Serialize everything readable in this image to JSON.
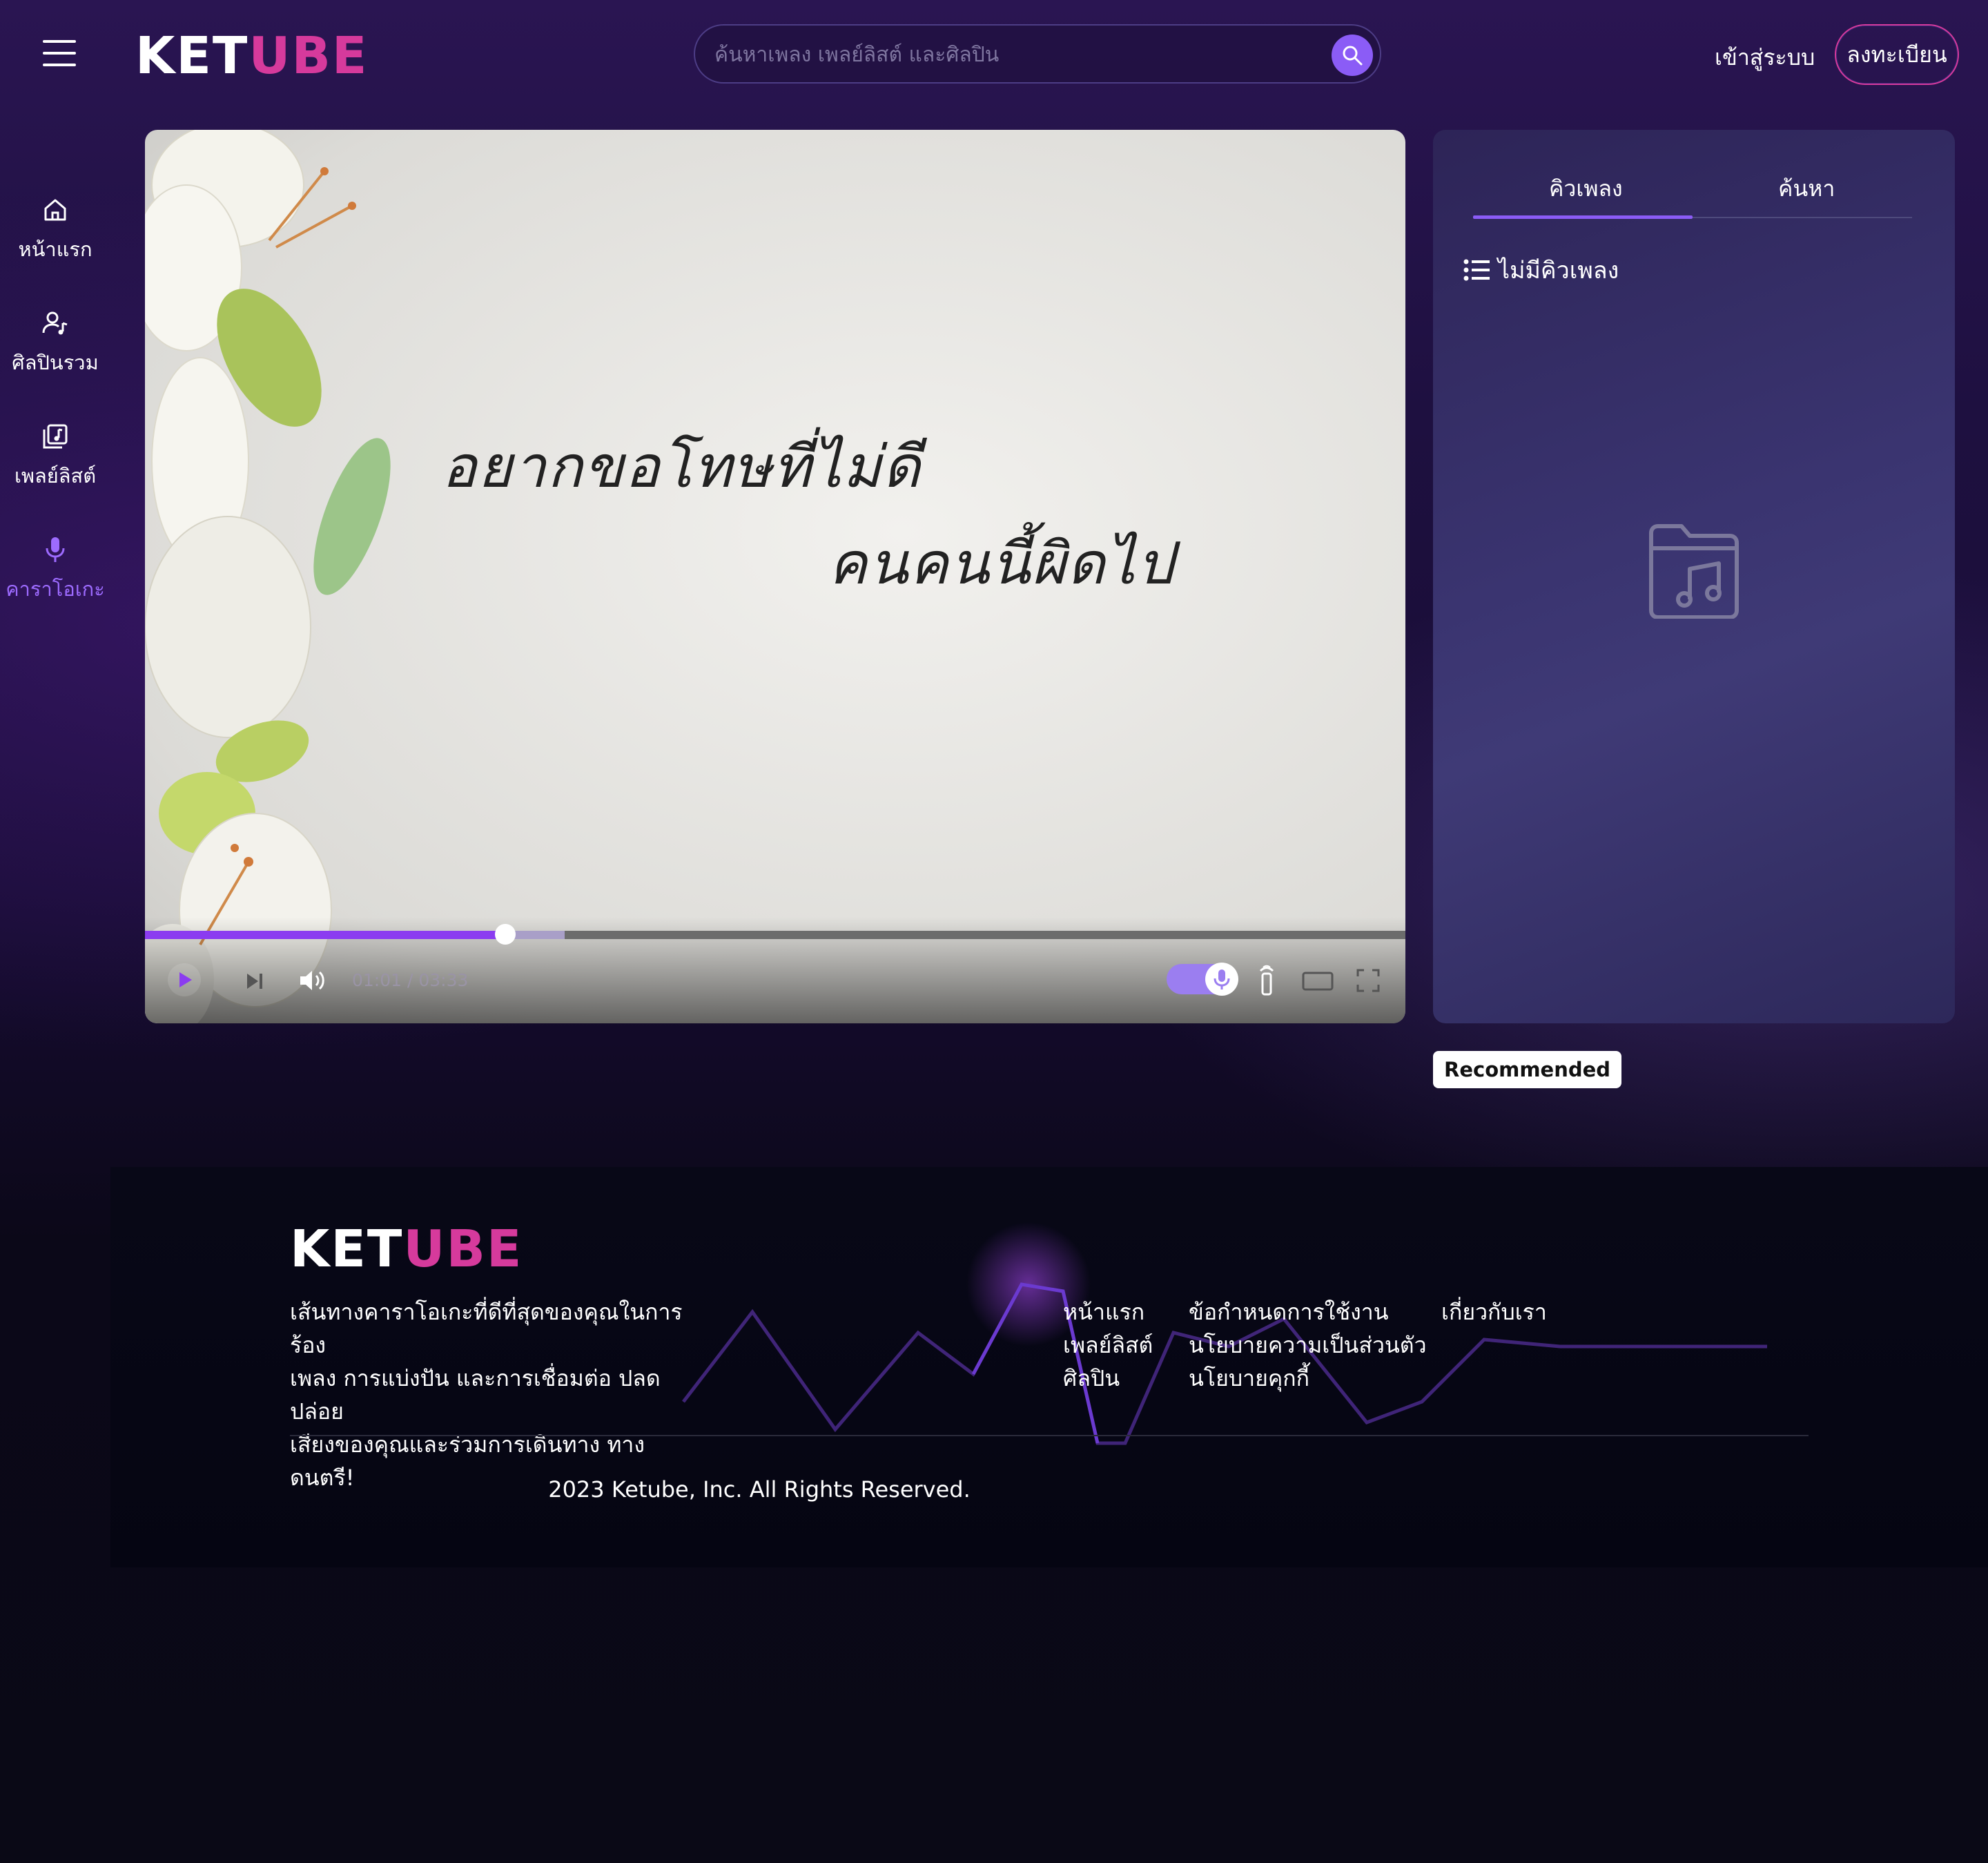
{
  "header": {
    "logo": {
      "part1": "KET",
      "part2": "ᑌBE",
      "colors": {
        "white": "#ffffff",
        "pink": "#d63a9c"
      }
    },
    "search_placeholder": "ค้นหาเพลง เพลย์ลิสต์ และศิลปิน",
    "login_label": "เข้าสู่ระบบ",
    "register_label": "ลงทะเบียน"
  },
  "sidebar": {
    "items": [
      {
        "label": "หน้าแรก",
        "icon": "home-icon"
      },
      {
        "label": "ศิลปินรวม",
        "icon": "artist-icon"
      },
      {
        "label": "เพลย์ลิสต์",
        "icon": "playlist-icon"
      },
      {
        "label": "คาราโอเกะ",
        "icon": "microphone-icon",
        "active": true
      }
    ]
  },
  "player": {
    "lyrics": [
      "อยากขอโทษที่ไม่ดี",
      "คนคนนี้ผิดไป"
    ],
    "current_time": "01:01",
    "duration": "03:33",
    "time_display": "01:01 / 03:33",
    "progress_fraction": 0.286,
    "buffered_fraction": 0.333,
    "vocal_toggle_on": true,
    "accent_color": "#8b3cf0"
  },
  "queue": {
    "tabs": [
      "คิวเพลง",
      "ค้นหา"
    ],
    "active_tab": 0,
    "empty_label": "ไม่มีคิวเพลง"
  },
  "recommended_label": "Recommended",
  "footer": {
    "description_lines": [
      "เส้นทางคาราโอเกะที่ดีที่สุดของคุณในการร้อง",
      "เพลง การแบ่งปัน และการเชื่อมต่อ ปลดปล่อย",
      "เสียงของคุณและร่วมการเดินทาง ทางดนตรี!"
    ],
    "col1": [
      "หน้าแรก",
      "เพลย์ลิสต์",
      "ศิลปิน"
    ],
    "col2": [
      "ข้อกำหนดการใช้งาน",
      "นโยบายความเป็นส่วนตัว",
      "นโยบายคุกกี้"
    ],
    "col3": [
      "เกี่ยวกับเรา"
    ],
    "copyright": "2023 Ketube, Inc. All Rights Reserved."
  }
}
